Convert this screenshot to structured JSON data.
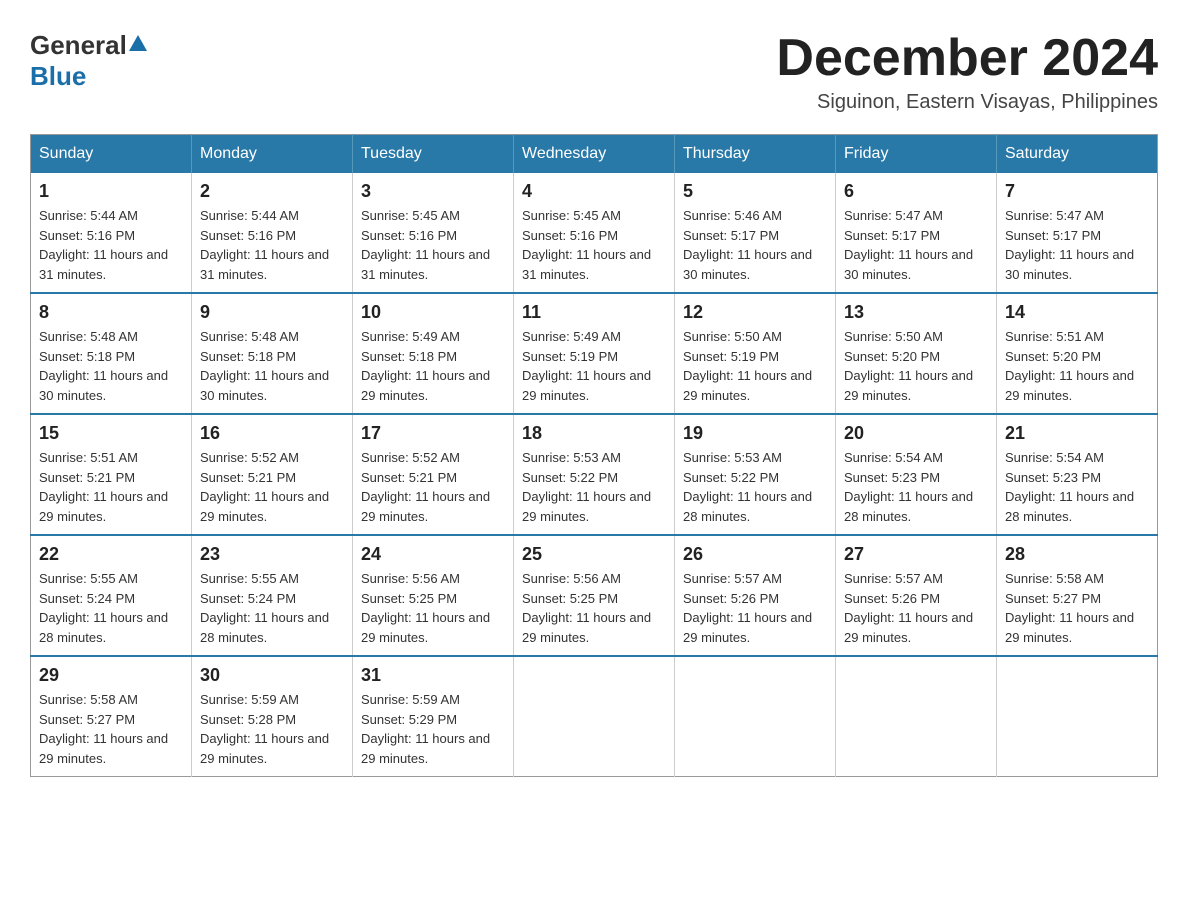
{
  "header": {
    "logo_general": "General",
    "logo_blue": "Blue",
    "month_title": "December 2024",
    "location": "Siguinon, Eastern Visayas, Philippines"
  },
  "weekdays": [
    "Sunday",
    "Monday",
    "Tuesday",
    "Wednesday",
    "Thursday",
    "Friday",
    "Saturday"
  ],
  "weeks": [
    [
      {
        "day": "1",
        "sunrise": "Sunrise: 5:44 AM",
        "sunset": "Sunset: 5:16 PM",
        "daylight": "Daylight: 11 hours and 31 minutes."
      },
      {
        "day": "2",
        "sunrise": "Sunrise: 5:44 AM",
        "sunset": "Sunset: 5:16 PM",
        "daylight": "Daylight: 11 hours and 31 minutes."
      },
      {
        "day": "3",
        "sunrise": "Sunrise: 5:45 AM",
        "sunset": "Sunset: 5:16 PM",
        "daylight": "Daylight: 11 hours and 31 minutes."
      },
      {
        "day": "4",
        "sunrise": "Sunrise: 5:45 AM",
        "sunset": "Sunset: 5:16 PM",
        "daylight": "Daylight: 11 hours and 31 minutes."
      },
      {
        "day": "5",
        "sunrise": "Sunrise: 5:46 AM",
        "sunset": "Sunset: 5:17 PM",
        "daylight": "Daylight: 11 hours and 30 minutes."
      },
      {
        "day": "6",
        "sunrise": "Sunrise: 5:47 AM",
        "sunset": "Sunset: 5:17 PM",
        "daylight": "Daylight: 11 hours and 30 minutes."
      },
      {
        "day": "7",
        "sunrise": "Sunrise: 5:47 AM",
        "sunset": "Sunset: 5:17 PM",
        "daylight": "Daylight: 11 hours and 30 minutes."
      }
    ],
    [
      {
        "day": "8",
        "sunrise": "Sunrise: 5:48 AM",
        "sunset": "Sunset: 5:18 PM",
        "daylight": "Daylight: 11 hours and 30 minutes."
      },
      {
        "day": "9",
        "sunrise": "Sunrise: 5:48 AM",
        "sunset": "Sunset: 5:18 PM",
        "daylight": "Daylight: 11 hours and 30 minutes."
      },
      {
        "day": "10",
        "sunrise": "Sunrise: 5:49 AM",
        "sunset": "Sunset: 5:18 PM",
        "daylight": "Daylight: 11 hours and 29 minutes."
      },
      {
        "day": "11",
        "sunrise": "Sunrise: 5:49 AM",
        "sunset": "Sunset: 5:19 PM",
        "daylight": "Daylight: 11 hours and 29 minutes."
      },
      {
        "day": "12",
        "sunrise": "Sunrise: 5:50 AM",
        "sunset": "Sunset: 5:19 PM",
        "daylight": "Daylight: 11 hours and 29 minutes."
      },
      {
        "day": "13",
        "sunrise": "Sunrise: 5:50 AM",
        "sunset": "Sunset: 5:20 PM",
        "daylight": "Daylight: 11 hours and 29 minutes."
      },
      {
        "day": "14",
        "sunrise": "Sunrise: 5:51 AM",
        "sunset": "Sunset: 5:20 PM",
        "daylight": "Daylight: 11 hours and 29 minutes."
      }
    ],
    [
      {
        "day": "15",
        "sunrise": "Sunrise: 5:51 AM",
        "sunset": "Sunset: 5:21 PM",
        "daylight": "Daylight: 11 hours and 29 minutes."
      },
      {
        "day": "16",
        "sunrise": "Sunrise: 5:52 AM",
        "sunset": "Sunset: 5:21 PM",
        "daylight": "Daylight: 11 hours and 29 minutes."
      },
      {
        "day": "17",
        "sunrise": "Sunrise: 5:52 AM",
        "sunset": "Sunset: 5:21 PM",
        "daylight": "Daylight: 11 hours and 29 minutes."
      },
      {
        "day": "18",
        "sunrise": "Sunrise: 5:53 AM",
        "sunset": "Sunset: 5:22 PM",
        "daylight": "Daylight: 11 hours and 29 minutes."
      },
      {
        "day": "19",
        "sunrise": "Sunrise: 5:53 AM",
        "sunset": "Sunset: 5:22 PM",
        "daylight": "Daylight: 11 hours and 28 minutes."
      },
      {
        "day": "20",
        "sunrise": "Sunrise: 5:54 AM",
        "sunset": "Sunset: 5:23 PM",
        "daylight": "Daylight: 11 hours and 28 minutes."
      },
      {
        "day": "21",
        "sunrise": "Sunrise: 5:54 AM",
        "sunset": "Sunset: 5:23 PM",
        "daylight": "Daylight: 11 hours and 28 minutes."
      }
    ],
    [
      {
        "day": "22",
        "sunrise": "Sunrise: 5:55 AM",
        "sunset": "Sunset: 5:24 PM",
        "daylight": "Daylight: 11 hours and 28 minutes."
      },
      {
        "day": "23",
        "sunrise": "Sunrise: 5:55 AM",
        "sunset": "Sunset: 5:24 PM",
        "daylight": "Daylight: 11 hours and 28 minutes."
      },
      {
        "day": "24",
        "sunrise": "Sunrise: 5:56 AM",
        "sunset": "Sunset: 5:25 PM",
        "daylight": "Daylight: 11 hours and 29 minutes."
      },
      {
        "day": "25",
        "sunrise": "Sunrise: 5:56 AM",
        "sunset": "Sunset: 5:25 PM",
        "daylight": "Daylight: 11 hours and 29 minutes."
      },
      {
        "day": "26",
        "sunrise": "Sunrise: 5:57 AM",
        "sunset": "Sunset: 5:26 PM",
        "daylight": "Daylight: 11 hours and 29 minutes."
      },
      {
        "day": "27",
        "sunrise": "Sunrise: 5:57 AM",
        "sunset": "Sunset: 5:26 PM",
        "daylight": "Daylight: 11 hours and 29 minutes."
      },
      {
        "day": "28",
        "sunrise": "Sunrise: 5:58 AM",
        "sunset": "Sunset: 5:27 PM",
        "daylight": "Daylight: 11 hours and 29 minutes."
      }
    ],
    [
      {
        "day": "29",
        "sunrise": "Sunrise: 5:58 AM",
        "sunset": "Sunset: 5:27 PM",
        "daylight": "Daylight: 11 hours and 29 minutes."
      },
      {
        "day": "30",
        "sunrise": "Sunrise: 5:59 AM",
        "sunset": "Sunset: 5:28 PM",
        "daylight": "Daylight: 11 hours and 29 minutes."
      },
      {
        "day": "31",
        "sunrise": "Sunrise: 5:59 AM",
        "sunset": "Sunset: 5:29 PM",
        "daylight": "Daylight: 11 hours and 29 minutes."
      },
      null,
      null,
      null,
      null
    ]
  ]
}
